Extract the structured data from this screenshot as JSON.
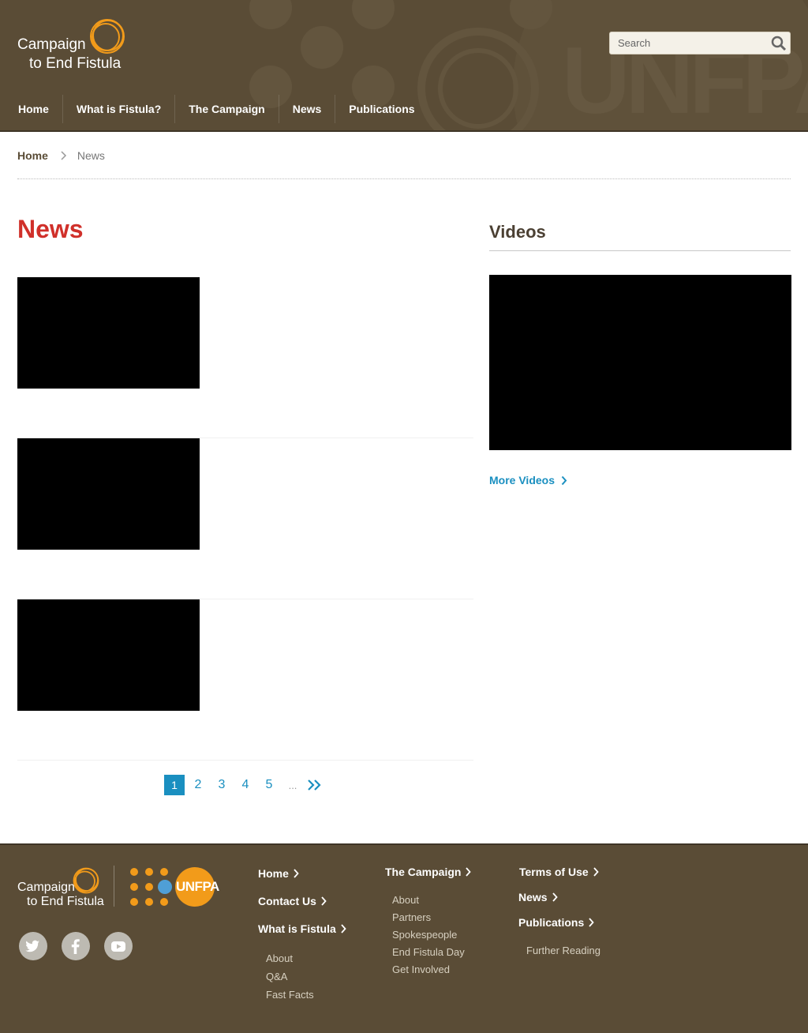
{
  "header": {
    "logo": {
      "line1": "Campaign",
      "line2": "to End Fistula"
    },
    "watermark": "UNFPA",
    "search": {
      "placeholder": "Search",
      "value": ""
    },
    "nav": [
      "Home",
      "What is Fistula?",
      "The Campaign",
      "News",
      "Publications"
    ]
  },
  "breadcrumb": {
    "home": "Home",
    "current": "News"
  },
  "main": {
    "title": "News",
    "news_items": [
      {},
      {},
      {}
    ],
    "pagination": {
      "pages": [
        "1",
        "2",
        "3",
        "4",
        "5"
      ],
      "active": "1",
      "ellipsis": "..."
    }
  },
  "sidebar": {
    "title": "Videos",
    "more_label": "More Videos"
  },
  "footer": {
    "logo": {
      "line1": "Campaign",
      "line2": "to End Fistula"
    },
    "partner": "UNFPA",
    "social": [
      "twitter",
      "facebook",
      "youtube"
    ],
    "col1": {
      "links": [
        "Home",
        "Contact Us",
        "What is Fistula"
      ],
      "sub": [
        "About",
        "Q&A",
        "Fast Facts"
      ]
    },
    "col2": {
      "link": "The Campaign",
      "sub": [
        "About",
        "Partners",
        "Spokespeople",
        "End Fistula Day",
        "Get Involved"
      ]
    },
    "col3": {
      "links": [
        "Terms of Use",
        "News",
        "Publications"
      ],
      "sub": [
        "Further Reading"
      ]
    }
  },
  "colors": {
    "header_bg": "#5a4c36",
    "title_red": "#d0302a",
    "link_blue": "#1a8fc0",
    "logo_orange": "#f29b1a"
  }
}
